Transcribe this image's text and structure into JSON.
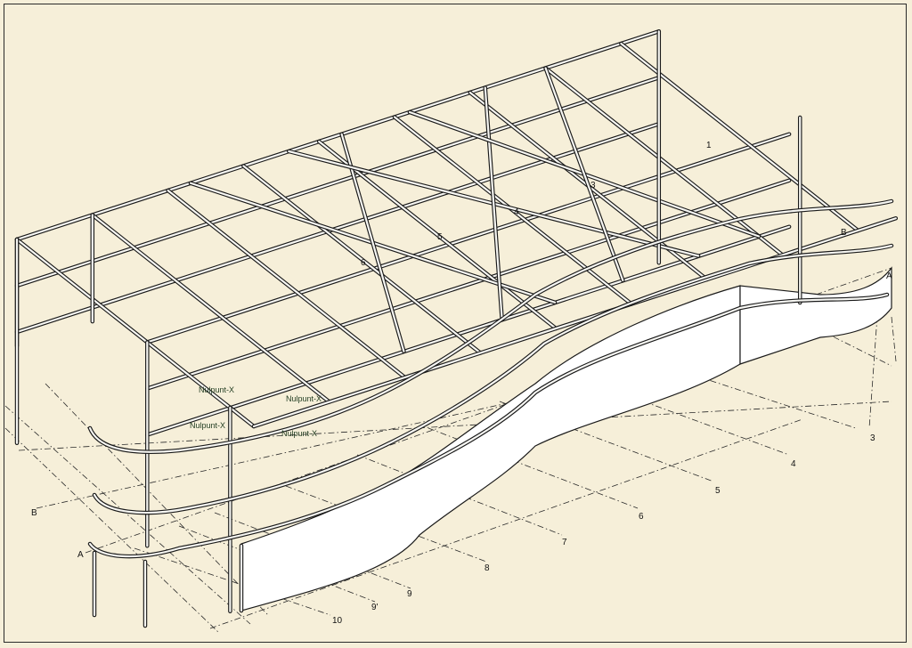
{
  "drawing": {
    "grid_labels_numeric": [
      "1",
      "3",
      "4",
      "5",
      "6",
      "7",
      "8",
      "9",
      "9'",
      "10"
    ],
    "grid_labels_letters": [
      "A",
      "B"
    ],
    "roof_numbers": [
      "1",
      "3",
      "4",
      "5",
      "6"
    ],
    "zero_point_labels": [
      "Nulpunt-X",
      "Nulpunt-X",
      "Nulpunt-X",
      "Nulpunt-X"
    ],
    "colors": {
      "background": "#f6efd9",
      "steel": "#1a1a1a",
      "glazing": "#ffffff"
    }
  }
}
